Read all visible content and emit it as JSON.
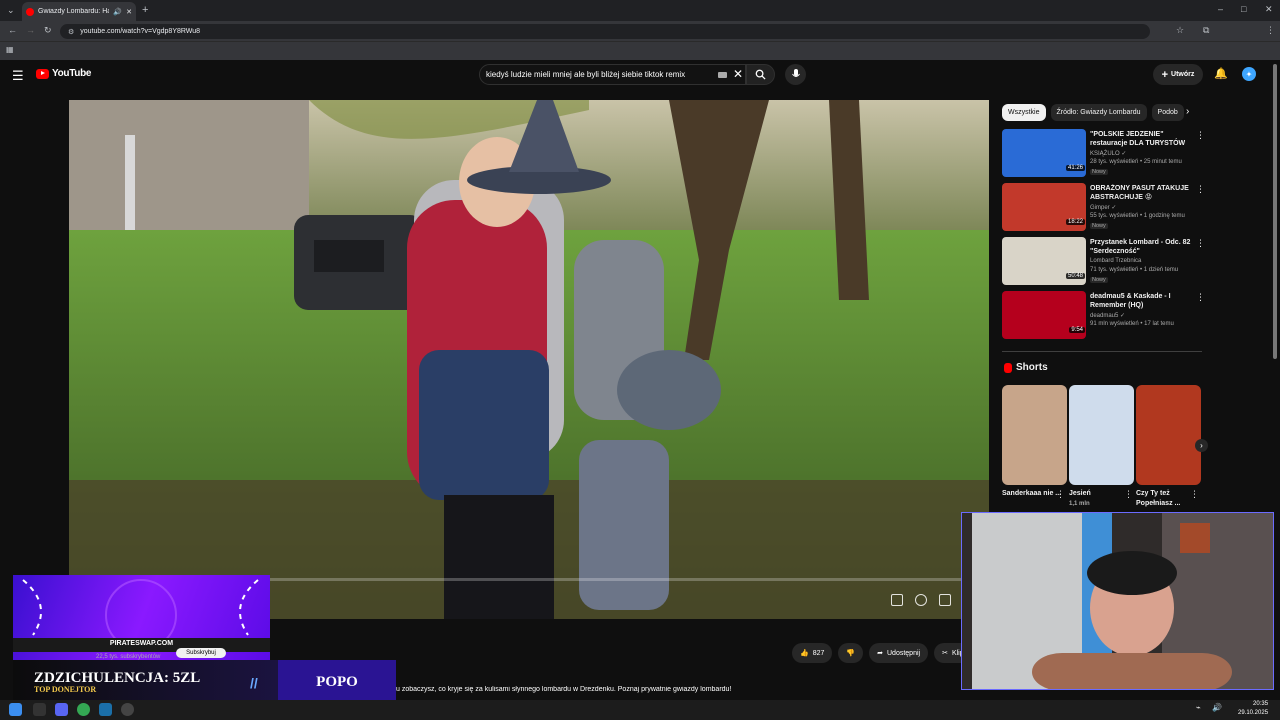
{
  "browser": {
    "tab_title": "Gwiazdy Lombardu: Hallo...",
    "url": "youtube.com/watch?v=Vgdp8Y8RWu8"
  },
  "header": {
    "logo_text": "YouTube",
    "search_value": "kiedyś ludzie mieli mniej ale byli bliżej siebie tiktok remix",
    "create_label": "Utwórz"
  },
  "player": {
    "progress_fraction": 0.0
  },
  "actions": {
    "likes": "827",
    "share_label": "Udostępnij",
    "clip_label": "Klip"
  },
  "description_snippet": "u zobaczysz, co kryje się za kulisami słynnego lombardu w Drezdenku. Poznaj prywatnie gwiazdy lombardu!",
  "sidebar": {
    "chips": [
      "Wszystkie",
      "Źródło: Gwiazdy Lombardu",
      "Podob"
    ],
    "recommendations": [
      {
        "title": "\"POLSKIE JEDZENIE\" restauracje DLA TURYSTÓW w...",
        "channel": "KSIĄŻULO ✓",
        "meta": "28 tys. wyświetleń • 25 minut temu",
        "badge": "Nowy",
        "duration": "41:26",
        "color": "#2a6bd6"
      },
      {
        "title": "OBRAŻONY PASUT ATAKUJE ABSTRACHUJE 😡",
        "channel": "Gimper ✓",
        "meta": "55 tys. wyświetleń • 1 godzinę temu",
        "badge": "Nowy",
        "duration": "18:22",
        "color": "#c2392b"
      },
      {
        "title": "Przystanek Lombard - Odc. 82 \"Serdeczność\"",
        "channel": "Lombard Trzebnica",
        "meta": "71 tys. wyświetleń • 1 dzień temu",
        "badge": "Nowy",
        "duration": "50:48",
        "color": "#d9d4c8"
      },
      {
        "title": "deadmau5 & Kaskade - I Remember (HQ)",
        "channel": "deadmau5 ✓",
        "meta": "91 mln wyświetleń • 17 lat temu",
        "badge": "",
        "duration": "9:54",
        "color": "#b5001d"
      }
    ],
    "shorts_heading": "Shorts",
    "shorts": [
      {
        "title": "Sanderkaaa nie ...",
        "views": "",
        "color": "#c7a58a"
      },
      {
        "title": "Jesień",
        "views": "1,1 mln",
        "color": "#cfdcec"
      },
      {
        "title": "Czy Ty też Popełniasz ...",
        "views": "",
        "color": "#b1381f"
      }
    ]
  },
  "overlays": {
    "promo_site": "PIRATESWAP.COM",
    "promo_subscribers": "22,5 tys. subskrybentów",
    "promo_subscribe": "Subskrybuj",
    "donation_text": "ZDZICHULENCJA: 5ZL",
    "donation_subtitle": "TOP DONEJTOR",
    "donation_right": "POPO"
  },
  "taskbar": {
    "time": "20:35",
    "date": "29.10.2025"
  }
}
